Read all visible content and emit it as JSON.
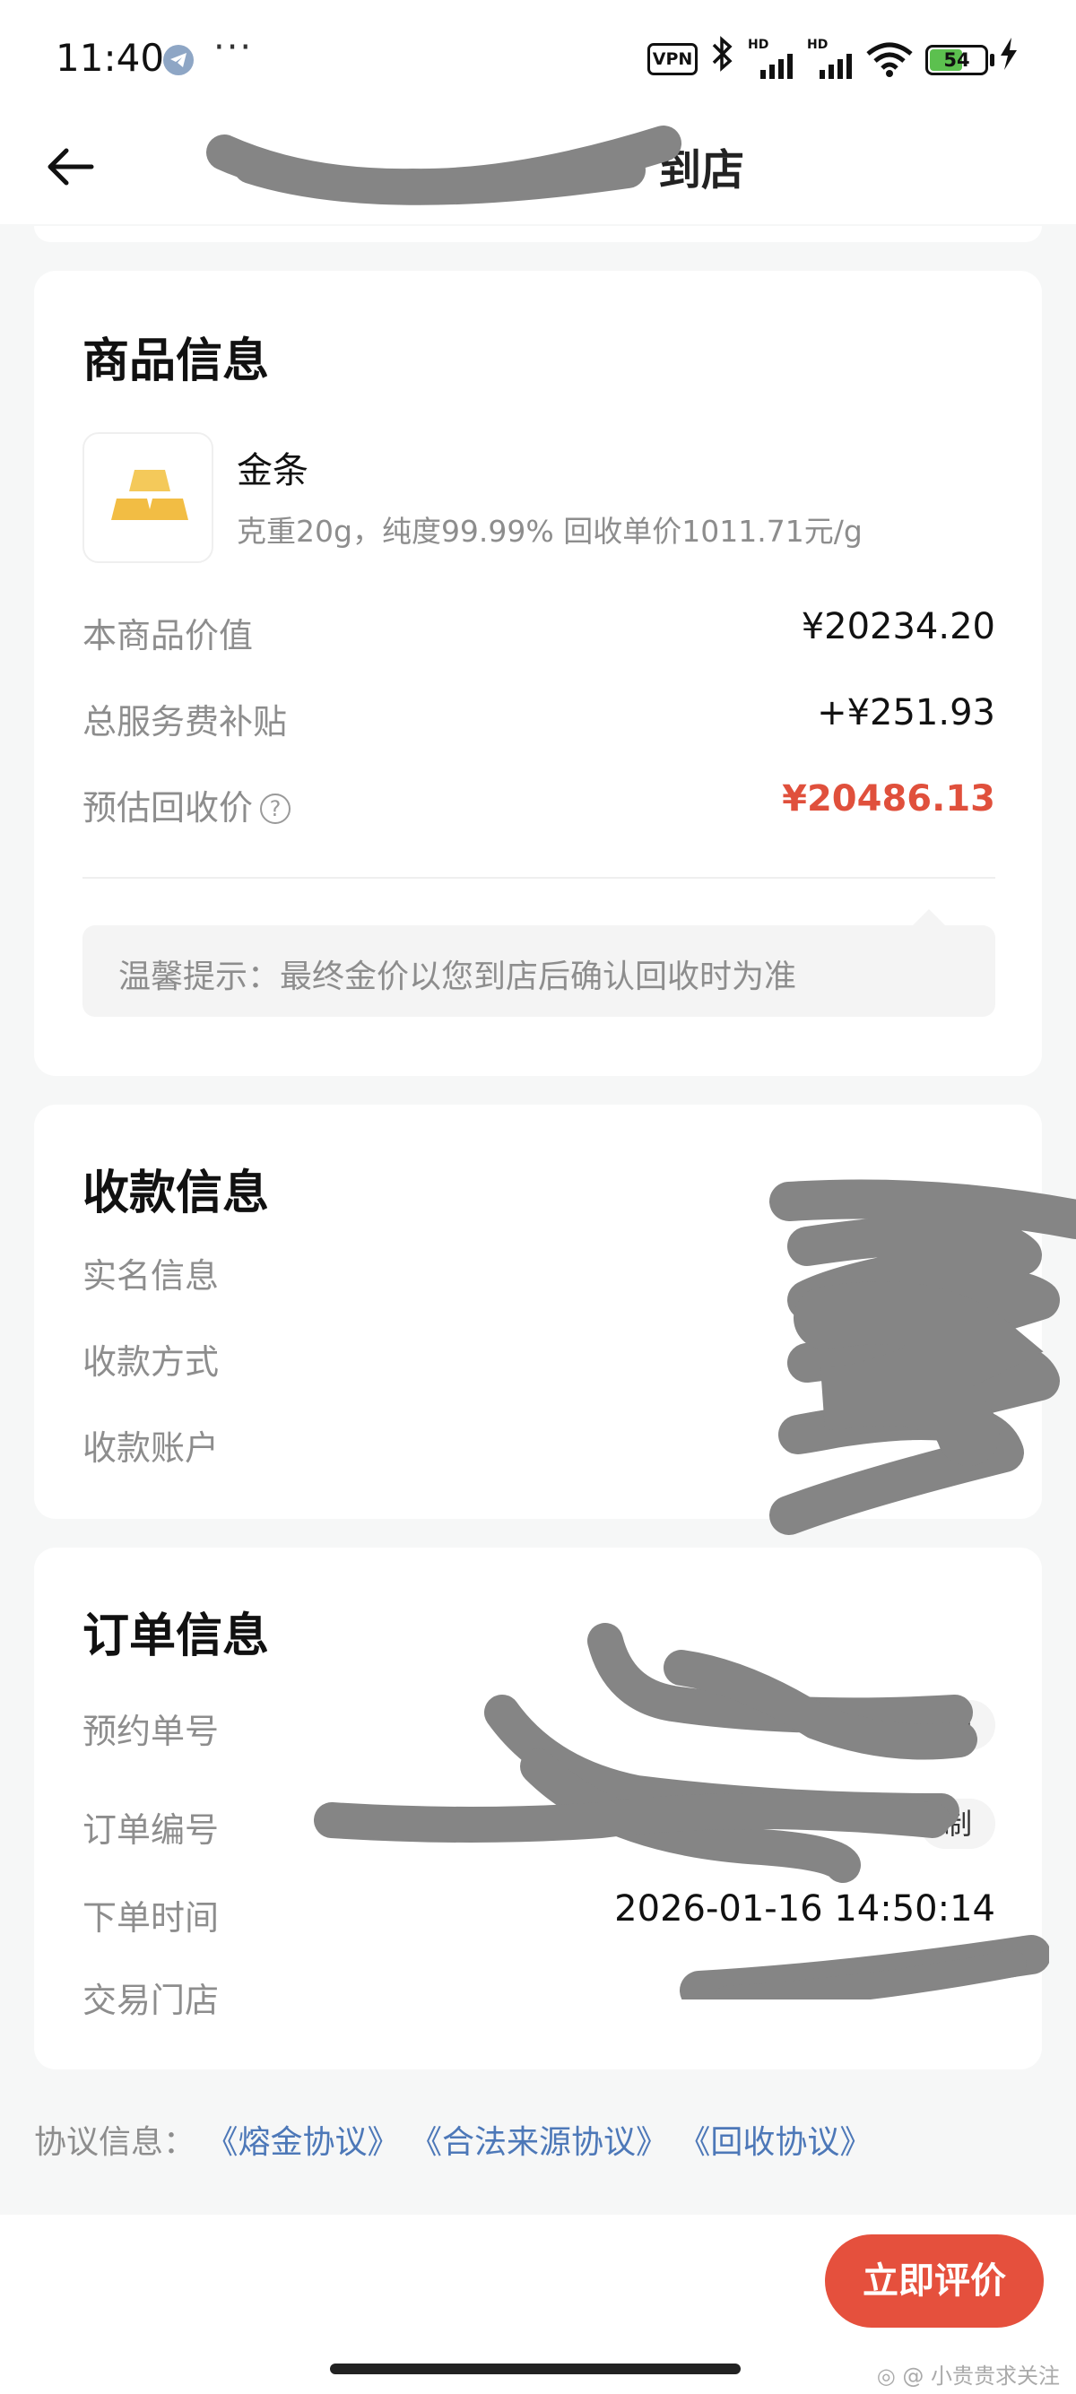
{
  "status_bar": {
    "time": "11:40",
    "dots": "···",
    "vpn": "VPN",
    "hd1": "HD",
    "hd2": "HD",
    "battery": "54",
    "icons": [
      "telegram-icon",
      "bluetooth-icon",
      "signal-icon",
      "wifi-icon",
      "battery-icon",
      "charging-icon"
    ]
  },
  "nav": {
    "title_visible": "到店"
  },
  "product_card": {
    "title": "商品信息",
    "product_name": "金条",
    "product_spec": "克重20g，纯度99.99% 回收单价1011.71元/g",
    "rows": [
      {
        "label": "本商品价值",
        "value": "¥20234.20"
      },
      {
        "label": "总服务费补贴",
        "value": "+¥251.93"
      },
      {
        "label": "预估回收价",
        "value": "¥20486.13"
      }
    ],
    "help_glyph": "?",
    "tip": "温馨提示：最终金价以您到店后确认回收时为准"
  },
  "payment_card": {
    "title": "收款信息",
    "rows": [
      "实名信息",
      "收款方式",
      "收款账户"
    ]
  },
  "order_card": {
    "title": "订单信息",
    "rows": [
      {
        "label": "预约单号",
        "value": ""
      },
      {
        "label": "订单编号",
        "value": ""
      },
      {
        "label": "下单时间",
        "value": "2026-01-16 14:50:14"
      },
      {
        "label": "交易门店",
        "value": ""
      }
    ],
    "copy_label_1": "复制",
    "copy_label_2": "制"
  },
  "agreement": {
    "prefix": "协议信息：",
    "links": [
      "《熔金协议》",
      "《合法来源协议》",
      "《回收协议》"
    ]
  },
  "bottom": {
    "review_button": "立即评价",
    "watermark": "◎ @ 小贵贵求关注"
  },
  "colors": {
    "accent_red": "#e5503d",
    "price_red": "#e0503c",
    "link_blue": "#4d78b8",
    "gold": "#f2c14e"
  }
}
